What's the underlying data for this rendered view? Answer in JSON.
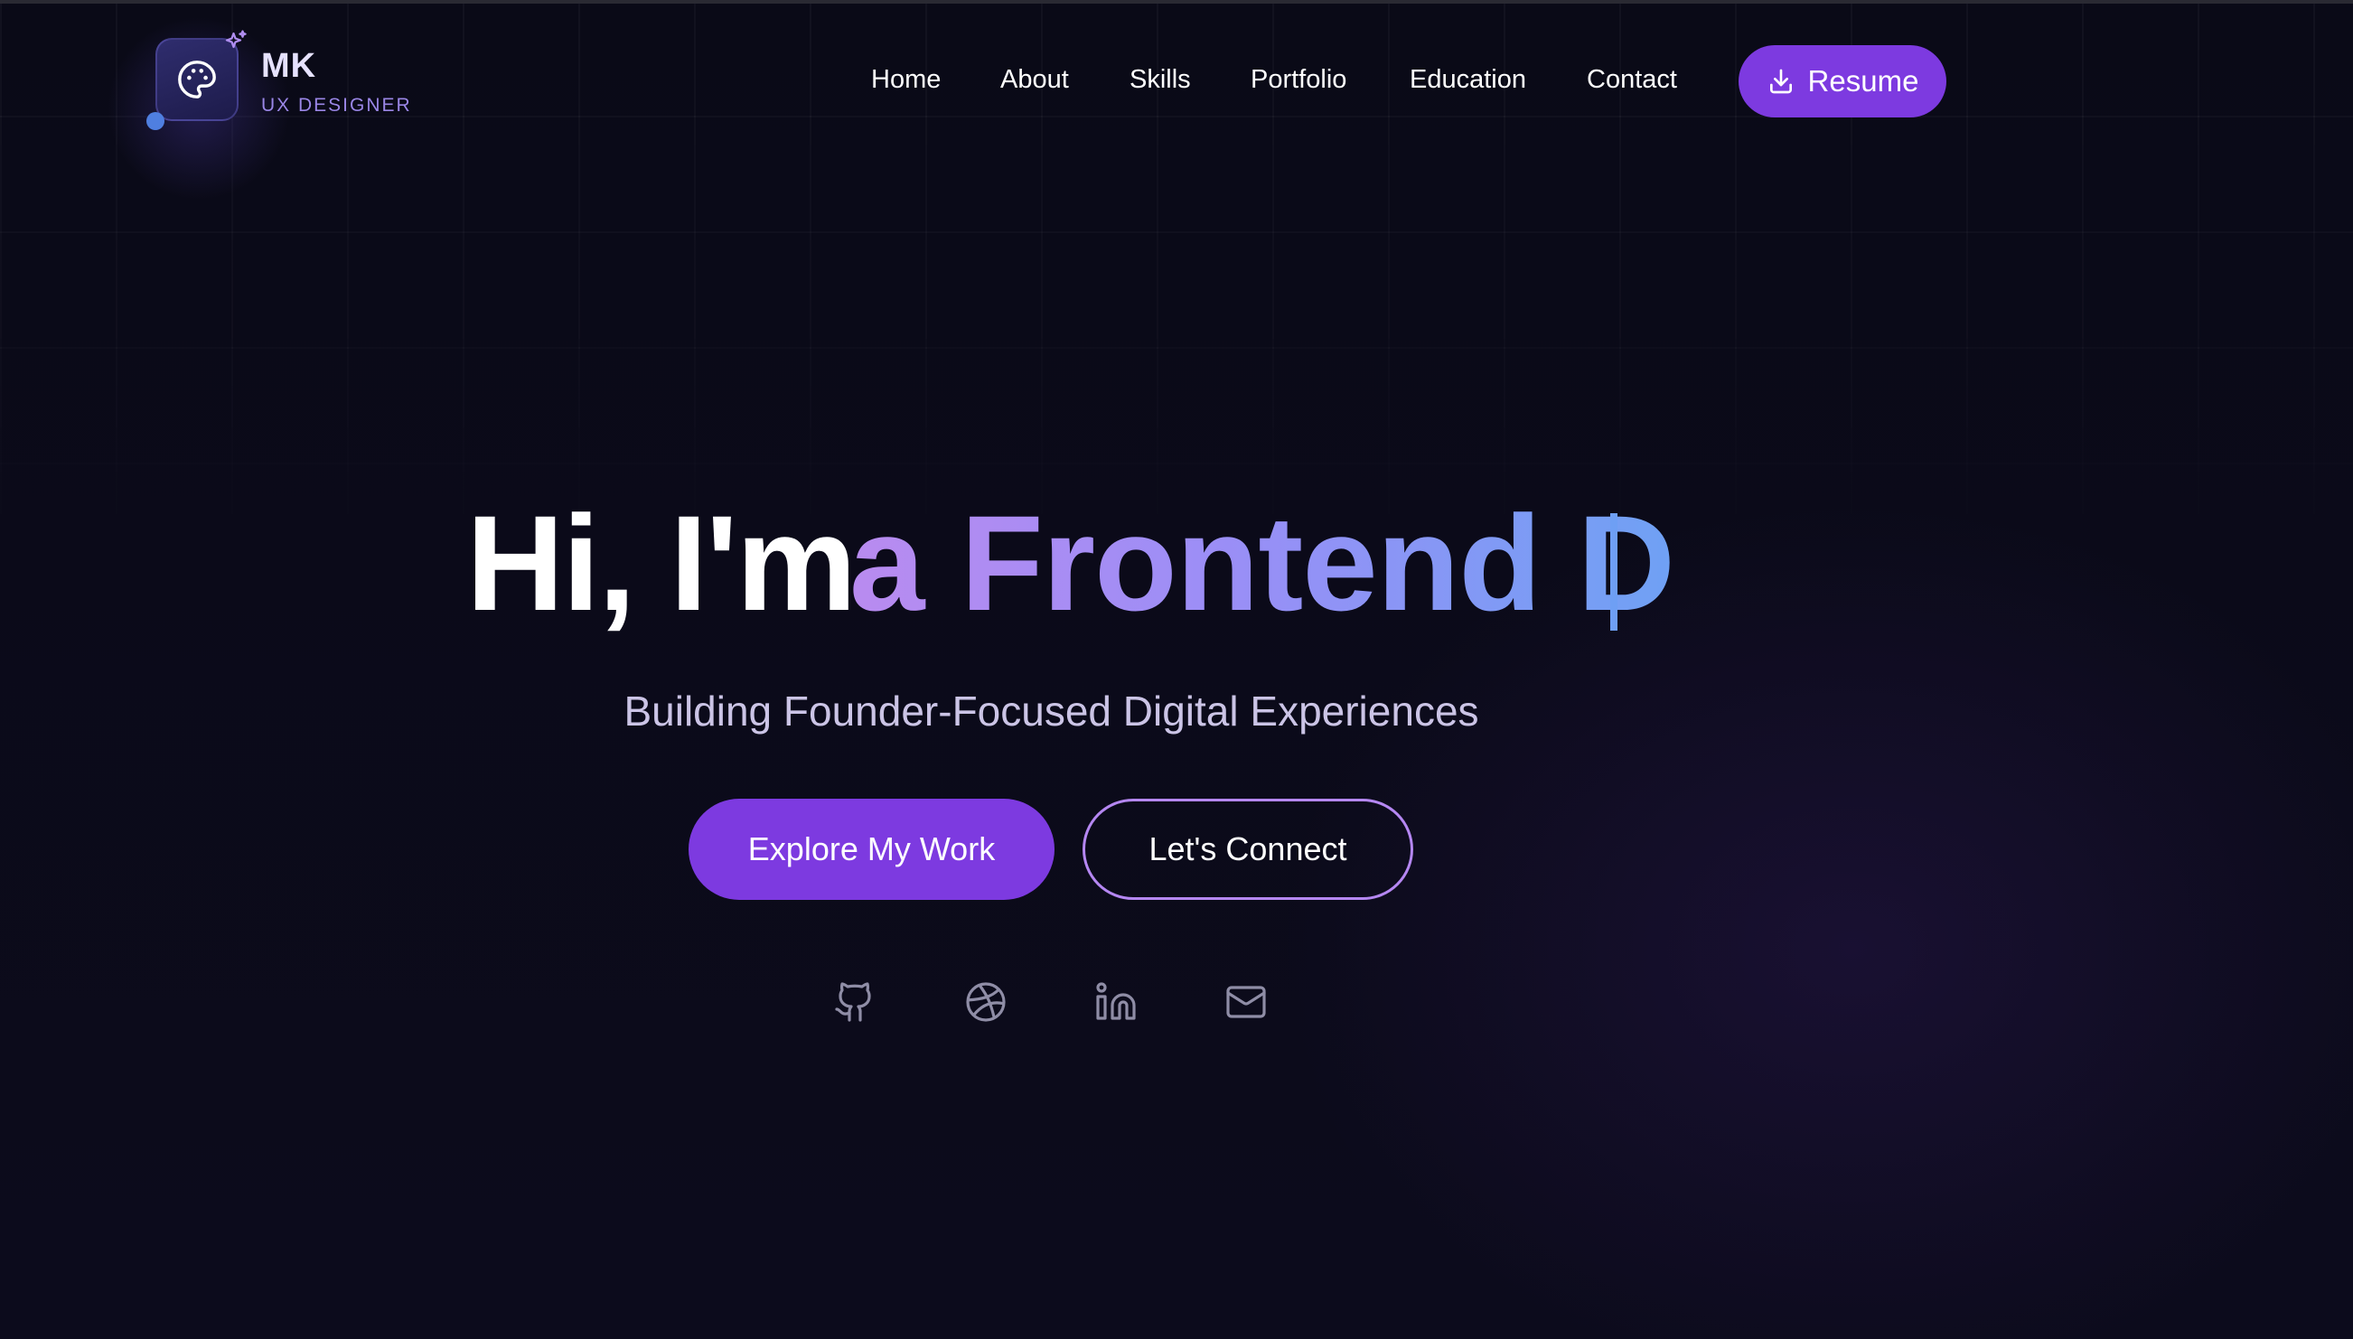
{
  "brand": {
    "initials": "MK",
    "role": "UX DESIGNER",
    "logo_icon": "palette-icon",
    "badge_icon": "sparkles-icon"
  },
  "nav": {
    "items": [
      {
        "label": "Home"
      },
      {
        "label": "About"
      },
      {
        "label": "Skills"
      },
      {
        "label": "Portfolio"
      },
      {
        "label": "Education"
      },
      {
        "label": "Contact"
      }
    ],
    "resume": {
      "label": "Resume",
      "icon": "download-icon"
    }
  },
  "hero": {
    "greeting": "Hi, I'm",
    "typed_text": "a Frontend D",
    "cursor": "|",
    "subtitle": "Building Founder-Focused Digital Experiences",
    "primary_cta": "Explore My Work",
    "secondary_cta": "Let's Connect"
  },
  "social": [
    {
      "icon": "github-icon"
    },
    {
      "icon": "dribbble-icon"
    },
    {
      "icon": "linkedin-icon"
    },
    {
      "icon": "mail-icon"
    }
  ],
  "colors": {
    "background": "#0b0a19",
    "accent": "#7d3ae0",
    "outline": "#b587f2",
    "gradient_start": "#b98bf0",
    "gradient_end": "#6fa1f4",
    "muted_icon": "#8f8da6"
  }
}
